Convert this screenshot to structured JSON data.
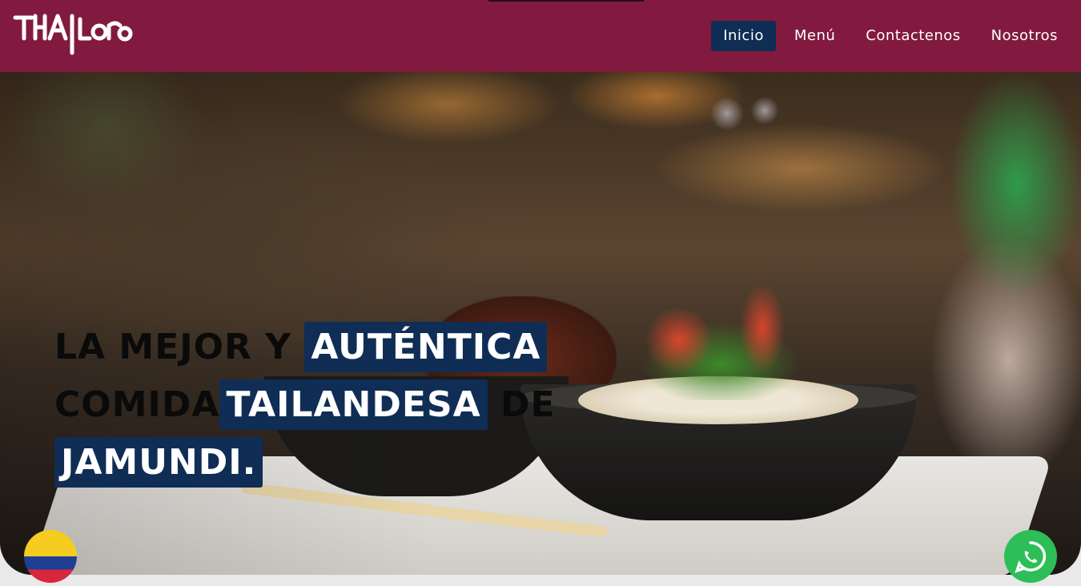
{
  "brand": {
    "logo_text": "THAILORO"
  },
  "nav": {
    "items": [
      {
        "label": "Inicio",
        "active": true
      },
      {
        "label": "Menú",
        "active": false
      },
      {
        "label": "Contactenos",
        "active": false
      },
      {
        "label": "Nosotros",
        "active": false
      }
    ]
  },
  "hero": {
    "line1_plain": "LA MEJOR Y",
    "line1_highlight": "AUTÉNTICA",
    "line2_plain": "COMIDA",
    "line2_highlight": "TAILANDESA",
    "line2_tail": "DE",
    "line3_highlight": "JAMUNDI."
  },
  "floating": {
    "language_icon": "colombia-flag-icon",
    "chat_icon": "whatsapp-icon"
  },
  "colors": {
    "header_bg": "#821a3f",
    "accent_navy": "#0f2d55",
    "whatsapp_green": "#2dbe57"
  }
}
